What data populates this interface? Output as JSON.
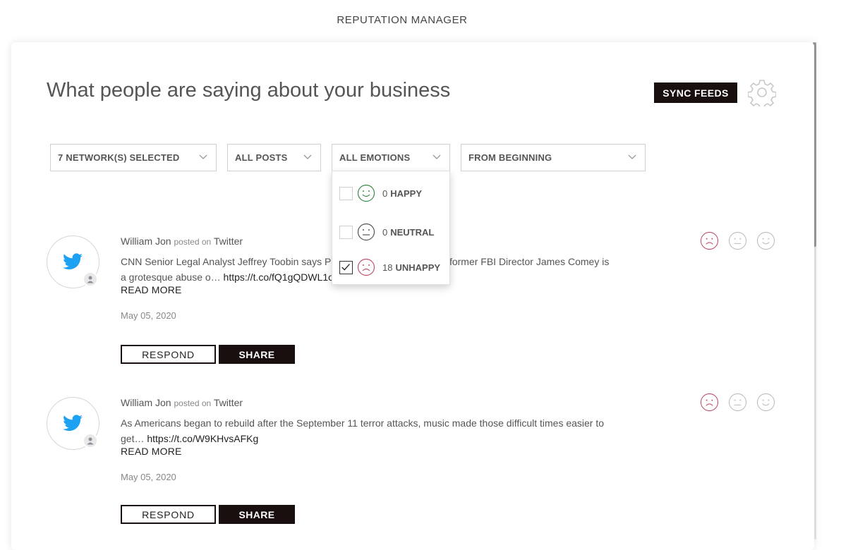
{
  "app": {
    "title": "REPUTATION MANAGER"
  },
  "header": {
    "heading": "What people are saying about your business",
    "sync_label": "SYNC FEEDS"
  },
  "filters": {
    "networks": "7 NETWORK(S) SELECTED",
    "posts": "ALL POSTS",
    "emotions": "ALL EMOTIONS",
    "range": "FROM BEGINNING"
  },
  "emotion_dropdown": {
    "items": [
      {
        "count": "0",
        "label": "HAPPY",
        "checked": false,
        "color": "#3a8a4a"
      },
      {
        "count": "0",
        "label": "NEUTRAL",
        "checked": false,
        "color": "#555555"
      },
      {
        "count": "18",
        "label": "UNHAPPY",
        "checked": true,
        "color": "#c0506a"
      }
    ]
  },
  "posts": [
    {
      "author": "William Jon",
      "posted_on": "posted on",
      "network": "Twitter",
      "text": "CNN Senior Legal Analyst Jeffrey Toobin says President Trump's attack on former FBI Director James Comey is a grotesque abuse o…",
      "link": "https://t.co/fQ1gQDWL1o",
      "read_more": "READ MORE",
      "date": "May 05, 2020",
      "respond": "RESPOND",
      "share": "SHARE"
    },
    {
      "author": "William Jon",
      "posted_on": "posted on",
      "network": "Twitter",
      "text": "As Americans began to rebuild after the September 11 terror attacks, music made those difficult times easier to get…",
      "link": "https://t.co/W9KHvsAFKg",
      "read_more": "READ MORE",
      "date": "May 05, 2020",
      "respond": "RESPOND",
      "share": "SHARE"
    }
  ],
  "colors": {
    "dark": "#1a0f0f",
    "unhappy": "#c0506a",
    "happy": "#3a8a4a",
    "twitter": "#1da1f2"
  }
}
